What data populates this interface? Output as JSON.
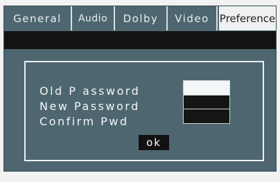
{
  "tabs": [
    {
      "label": "General"
    },
    {
      "label": "Audio"
    },
    {
      "label": "Dolby"
    },
    {
      "label": "Video"
    },
    {
      "label": "Preference"
    }
  ],
  "dialog": {
    "old_password_label": "Old P assword",
    "new_password_label": "New Password",
    "confirm_pwd_label": "Confirm Pwd",
    "ok_label": "ok"
  }
}
